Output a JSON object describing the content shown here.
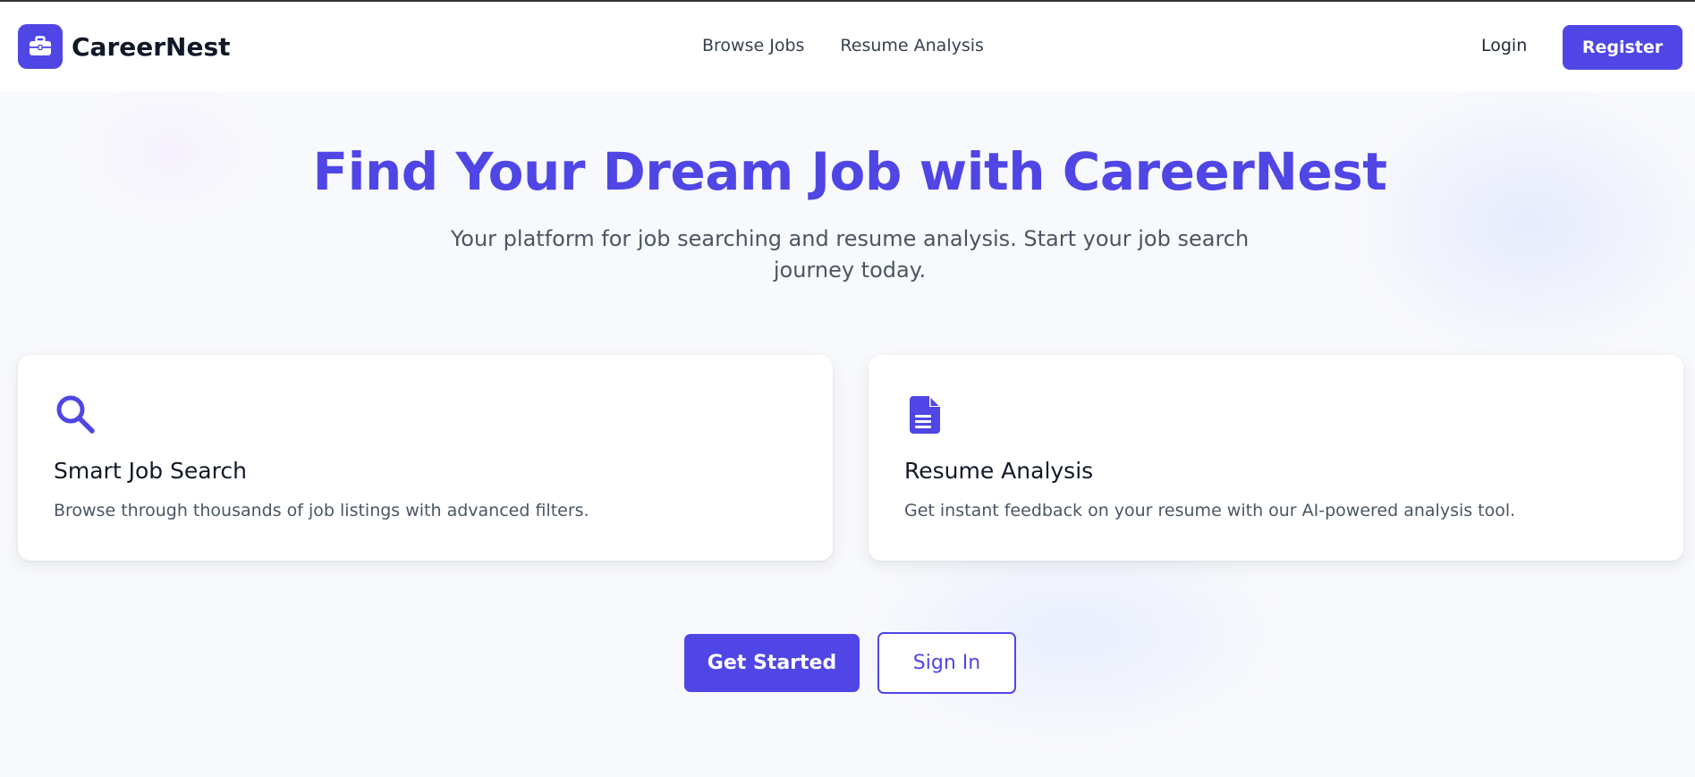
{
  "brand": {
    "name": "CareerNest",
    "logo_icon": "briefcase-icon",
    "accent": "#4f46e5"
  },
  "nav": {
    "links": [
      {
        "label": "Browse Jobs"
      },
      {
        "label": "Resume Analysis"
      }
    ],
    "login_label": "Login",
    "register_label": "Register"
  },
  "hero": {
    "title": "Find Your Dream Job with CareerNest",
    "subtitle": "Your platform for job searching and resume analysis. Start your job search journey today."
  },
  "features": [
    {
      "icon": "search-icon",
      "title": "Smart Job Search",
      "description": "Browse through thousands of job listings with advanced filters."
    },
    {
      "icon": "document-icon",
      "title": "Resume Analysis",
      "description": "Get instant feedback on your resume with our AI-powered analysis tool."
    }
  ],
  "cta": {
    "primary_label": "Get Started",
    "secondary_label": "Sign In"
  }
}
